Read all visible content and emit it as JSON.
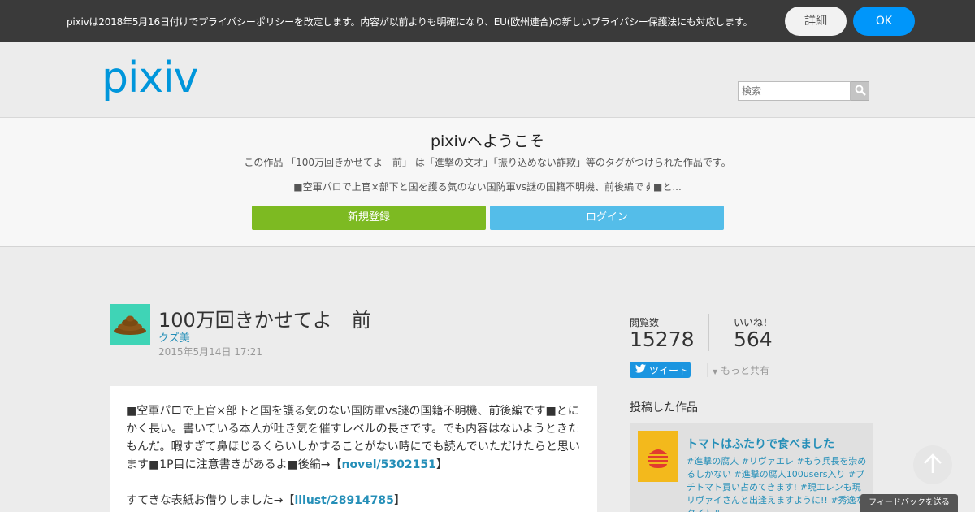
{
  "banner": {
    "text": "pixivは2018年5月16日付けでプライバシーポリシーを改定します。内容が以前よりも明確になり、EU(欧州連合)の新しいプライバシー保護法にも対応します。",
    "detail_label": "詳細",
    "ok_label": "OK"
  },
  "header": {
    "logo_text": "pixiv",
    "search_placeholder": "検索"
  },
  "welcome": {
    "title": "pixivへようこそ",
    "description": "この作品 「100万回きかせてよ　前」 は「進撃の文オ」「振り込めない詐欺」等のタグがつけられた作品です。",
    "caption": "■空軍パロで上官×部下と国を護る気のない国防軍vs謎の国籍不明機、前後編です■と...",
    "signup_label": "新規登録",
    "login_label": "ログイン"
  },
  "work": {
    "title": "100万回きかせてよ　前",
    "author": "クズ美",
    "date": "2015年5月14日 17:21",
    "caption_part1": "■空軍パロで上官×部下と国を護る気のない国防軍vs謎の国籍不明機、前後編です■とにかく長い。書いている本人が吐き気を催すレベルの長さです。でも内容はないようときたもんだ。暇すぎて鼻ほじるくらいしかすることがない時にでも読んでいただけたらと思います■1P目に注意書きがあるよ■後編→【",
    "caption_link1": "novel/5302151",
    "caption_part1_end": "】",
    "caption_part2": "すてきな表紙お借りしました→【",
    "caption_link2": "illust/28914785",
    "caption_part2_end": "】"
  },
  "stats": {
    "views_label": "閲覧数",
    "views_value": "15278",
    "likes_label": "いいね！",
    "likes_value": "564",
    "tweet_label": "ツイート",
    "share_more_label": "もっと共有"
  },
  "posted": {
    "section_title": "投稿した作品",
    "item_title": "トマトはふたりで食べました",
    "item_tags": "#進撃の腐人 #リヴァエレ #もう兵長を崇めるしかない #進撃の腐人100users入り #プチトマト買い占めてきます! #現エレンも現リヴァイさんと出逢えますように!! #秀逸なタイトル"
  },
  "feedback_label": "フィードバックを送る",
  "colors": {
    "brand": "#0096db",
    "ok_button": "#0096fa",
    "signup": "#7dba22",
    "login": "#54bde9",
    "link": "#258fb8"
  }
}
